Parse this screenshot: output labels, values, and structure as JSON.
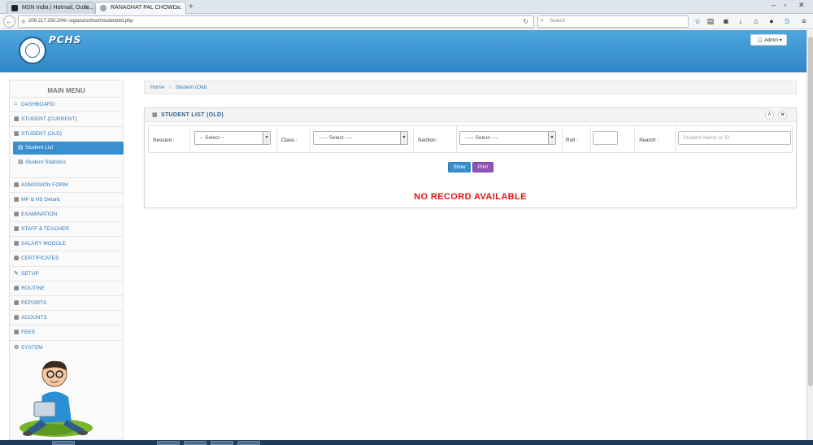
{
  "browser": {
    "tabs": [
      {
        "label": "MSN India | Hotmail, Outlo...",
        "active": false
      },
      {
        "label": "RANAGHAT PAL CHOWD...",
        "active": true
      }
    ],
    "url": "209.217.250.204/~siglass/school/studentold.php",
    "search_placeholder": "Search"
  },
  "header": {
    "brand": "PCHS",
    "admin_label": "Admin"
  },
  "sidebar": {
    "title": "MAIN MENU",
    "items": [
      {
        "label": "DASHBOARD",
        "icon": "home-icon"
      },
      {
        "label": "STUDENT (CURRENT)",
        "icon": "grid-icon"
      },
      {
        "label": "STUDENT (OLD)",
        "icon": "grid-icon"
      }
    ],
    "sub_items": [
      {
        "label": "Student List",
        "icon": "list-icon",
        "active": true
      },
      {
        "label": "Student Statistics",
        "icon": "list-icon",
        "active": false
      }
    ],
    "more_items": [
      {
        "label": "ADMISSION FORM",
        "icon": "grid-icon"
      },
      {
        "label": "MP & HS Details",
        "icon": "grid-icon"
      },
      {
        "label": "EXAMINATION",
        "icon": "grid-icon"
      },
      {
        "label": "STAFF & TEACHER",
        "icon": "grid-icon"
      },
      {
        "label": "SALARY MODULE",
        "icon": "grid-icon"
      },
      {
        "label": "CERTIFICATES",
        "icon": "grid-icon"
      },
      {
        "label": "SETUP",
        "icon": "wrench-icon"
      },
      {
        "label": "ROUTINE",
        "icon": "grid-icon"
      },
      {
        "label": "REPORTS",
        "icon": "grid-icon"
      },
      {
        "label": "ACOUNTS",
        "icon": "grid-icon"
      },
      {
        "label": "FEES",
        "icon": "grid-icon"
      },
      {
        "label": "SYSTEM",
        "icon": "gears-icon"
      }
    ]
  },
  "breadcrumb": {
    "home": "Home",
    "current": "Student (Old)"
  },
  "panel": {
    "title": "STUDENT LIST (OLD)",
    "filters": {
      "session_label": "Session :",
      "session_value": "-- Select --",
      "class_label": "Class :",
      "class_value": "----- Select ----",
      "section_label": "Section :",
      "section_value": "----- Select ----",
      "roll_label": "Roll :",
      "roll_value": "",
      "search_label": "Search :",
      "search_placeholder": "Student Name or ID"
    },
    "show_label": "Show",
    "print_label": "Print",
    "message": "NO RECORD AVAILABLE"
  },
  "colors": {
    "header_blue": "#2f86c5",
    "active_blue": "#3a8fd0",
    "print_purple": "#8e53b6",
    "alert_red": "#e11414"
  }
}
